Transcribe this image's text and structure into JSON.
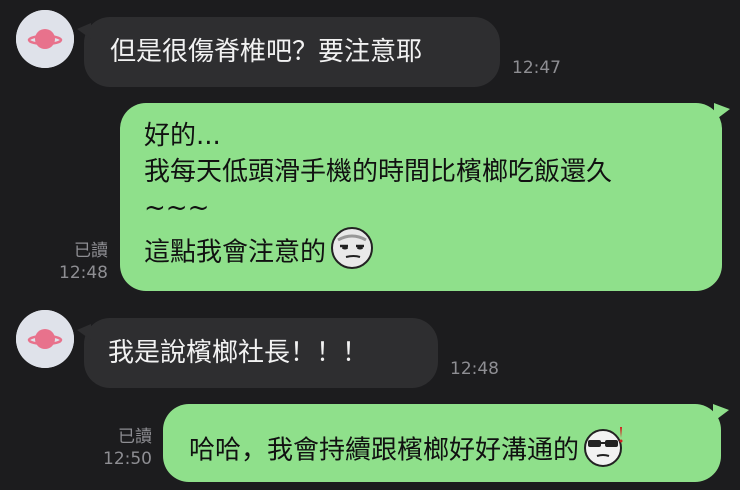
{
  "messages": [
    {
      "direction": "incoming",
      "text": "但是很傷脊椎吧？要注意耶",
      "time": "12:47",
      "avatar_icon": "planet-icon"
    },
    {
      "direction": "outgoing",
      "lines": [
        "好的...",
        "我每天低頭滑手機的時間比檳榔吃飯還久",
        "~~~",
        "這點我會注意的"
      ],
      "emoji": "smirk-face-icon",
      "read_label": "已讀",
      "time": "12:48"
    },
    {
      "direction": "incoming",
      "text": "我是說檳榔社長！！！",
      "time": "12:48",
      "avatar_icon": "planet-icon"
    },
    {
      "direction": "outgoing",
      "lines": [
        "哈哈，我會持續跟檳榔好好溝通的"
      ],
      "emoji": "sunglasses-face-icon",
      "read_label": "已讀",
      "time": "12:50"
    }
  ],
  "colors": {
    "background": "#1c1c1e",
    "incoming_bubble": "#2e2e30",
    "outgoing_bubble": "#8fe08b",
    "meta_text": "#8e8e93",
    "avatar_planet": "#e8728c"
  }
}
